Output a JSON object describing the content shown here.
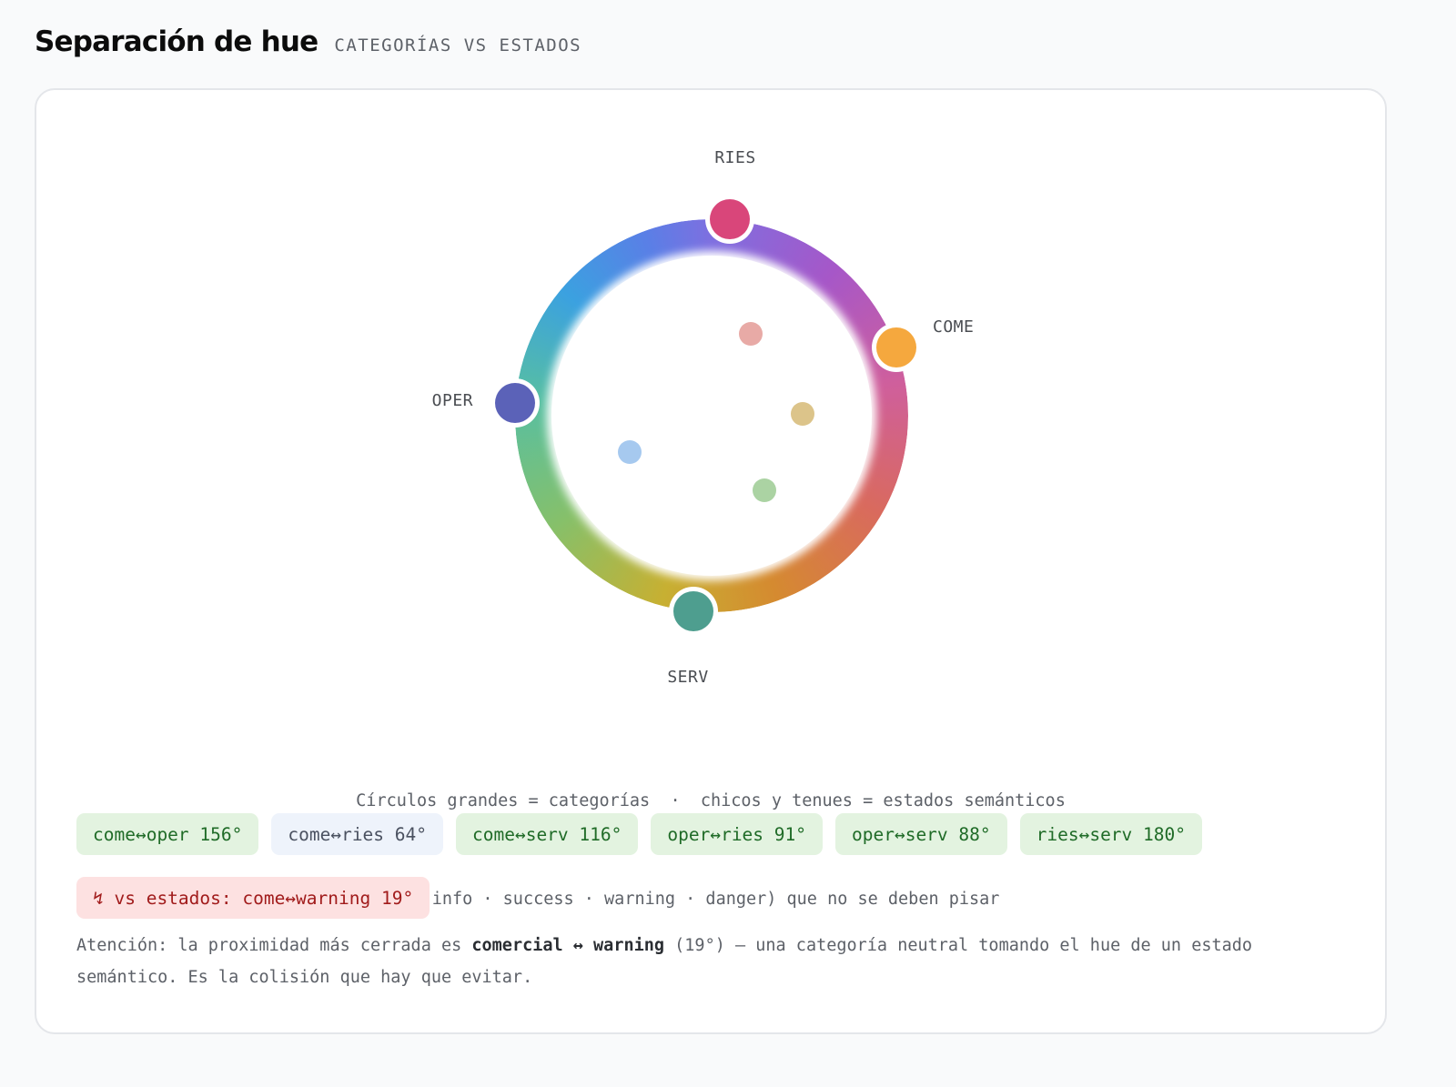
{
  "header": {
    "title": "Separación de hue",
    "subtitle": "CATEGORÍAS VS ESTADOS"
  },
  "wheel": {
    "categories": [
      {
        "id": "ries",
        "label": "RIES",
        "hue_deg": 339,
        "color": "#d9467a"
      },
      {
        "id": "come",
        "label": "COME",
        "hue_deg": 32,
        "color": "#f5a83e"
      },
      {
        "id": "serv",
        "label": "SERV",
        "hue_deg": 174,
        "color": "#4e9e8f"
      },
      {
        "id": "oper",
        "label": "OPER",
        "hue_deg": 235,
        "color": "#5b62b8"
      }
    ],
    "states": [
      {
        "id": "danger",
        "color": "#e8aaa6"
      },
      {
        "id": "warning",
        "color": "#dcc48a"
      },
      {
        "id": "info",
        "color": "#a6c9ef"
      },
      {
        "id": "success",
        "color": "#abd3a3"
      }
    ]
  },
  "legend": {
    "line1": "Círculos grandes = categorías  ·  chicos y tenues = estados semánticos",
    "line2": "(info · success · warning · danger) que no se deben pisar"
  },
  "chips": [
    {
      "label": "come↔oper 156°",
      "status": "ok"
    },
    {
      "label": "come↔ries 64°",
      "status": "neutral"
    },
    {
      "label": "come↔serv 116°",
      "status": "ok"
    },
    {
      "label": "oper↔ries 91°",
      "status": "ok"
    },
    {
      "label": "oper↔serv 88°",
      "status": "ok"
    },
    {
      "label": "ries↔serv 180°",
      "status": "ok"
    }
  ],
  "warning_chip": {
    "label": "↯ vs estados: come↔warning 19°",
    "status": "danger"
  },
  "note": {
    "prefix": "Atención: la proximidad más cerrada es ",
    "pair": "comercial ↔ warning",
    "suffix": " (19°) — una categoría neutral tomando el hue de un estado semántico. Es la colisión que hay que evitar."
  }
}
